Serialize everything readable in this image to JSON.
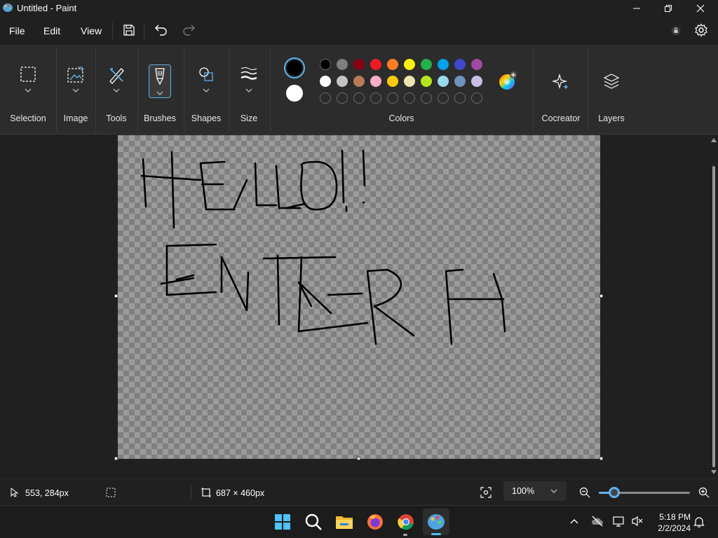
{
  "window": {
    "title": "Untitled - Paint"
  },
  "menu": {
    "file": "File",
    "edit": "Edit",
    "view": "View"
  },
  "ribbon": {
    "selection": "Selection",
    "image": "Image",
    "tools": "Tools",
    "brushes": "Brushes",
    "shapes": "Shapes",
    "size": "Size",
    "colors": "Colors",
    "cocreator": "Cocreator",
    "layers": "Layers"
  },
  "colors": {
    "primary": "#000000",
    "secondary": "#ffffff",
    "row1": [
      "#000000",
      "#7f7f7f",
      "#880015",
      "#ed1c24",
      "#ff7f27",
      "#fff200",
      "#22b14c",
      "#00a2e8",
      "#3f48cc",
      "#a349a4"
    ],
    "row2": [
      "#ffffff",
      "#c3c3c3",
      "#b97a57",
      "#ffaec9",
      "#ffc90e",
      "#efe4b0",
      "#b5e61d",
      "#99d9ea",
      "#7092be",
      "#c8bfe7"
    ]
  },
  "status": {
    "cursor_position": "553, 284px",
    "canvas_size": "687 × 460px",
    "zoom": "100%"
  },
  "taskbar": {
    "time": "5:18 PM",
    "date": "2/2/2024"
  }
}
